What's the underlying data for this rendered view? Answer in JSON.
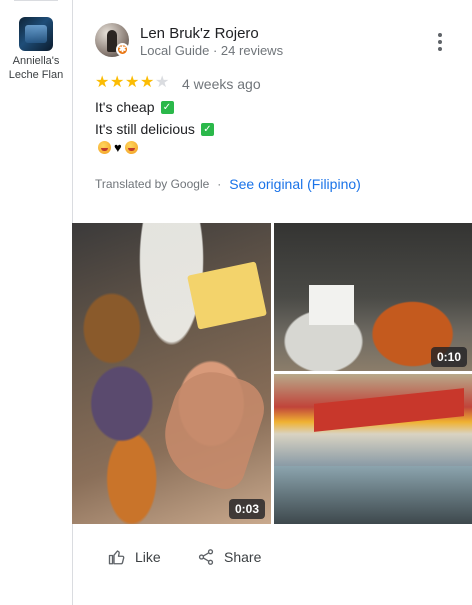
{
  "place": {
    "name": "Anniella's Leche Flan"
  },
  "review": {
    "reviewer_name": "Len Bruk'z Rojero",
    "reviewer_meta": "Local Guide · 24 reviews",
    "rating": 4,
    "rating_max": 5,
    "date": "4 weeks ago",
    "lines": [
      "It's cheap",
      "It's still delicious"
    ],
    "emoji": [
      "laughing-face",
      "black-heart",
      "laughing-face"
    ],
    "translated_label": "Translated by Google",
    "separator": "·",
    "see_original_label": "See original (Filipino)"
  },
  "media": [
    {
      "type": "video",
      "duration": "0:03"
    },
    {
      "type": "video",
      "duration": "0:10"
    },
    {
      "type": "photo"
    }
  ],
  "actions": {
    "like_label": "Like",
    "share_label": "Share"
  },
  "colors": {
    "accent": "#1a73e8",
    "star": "#fbbc04",
    "check": "#2bb84a",
    "guide_badge": "#e8710a"
  }
}
